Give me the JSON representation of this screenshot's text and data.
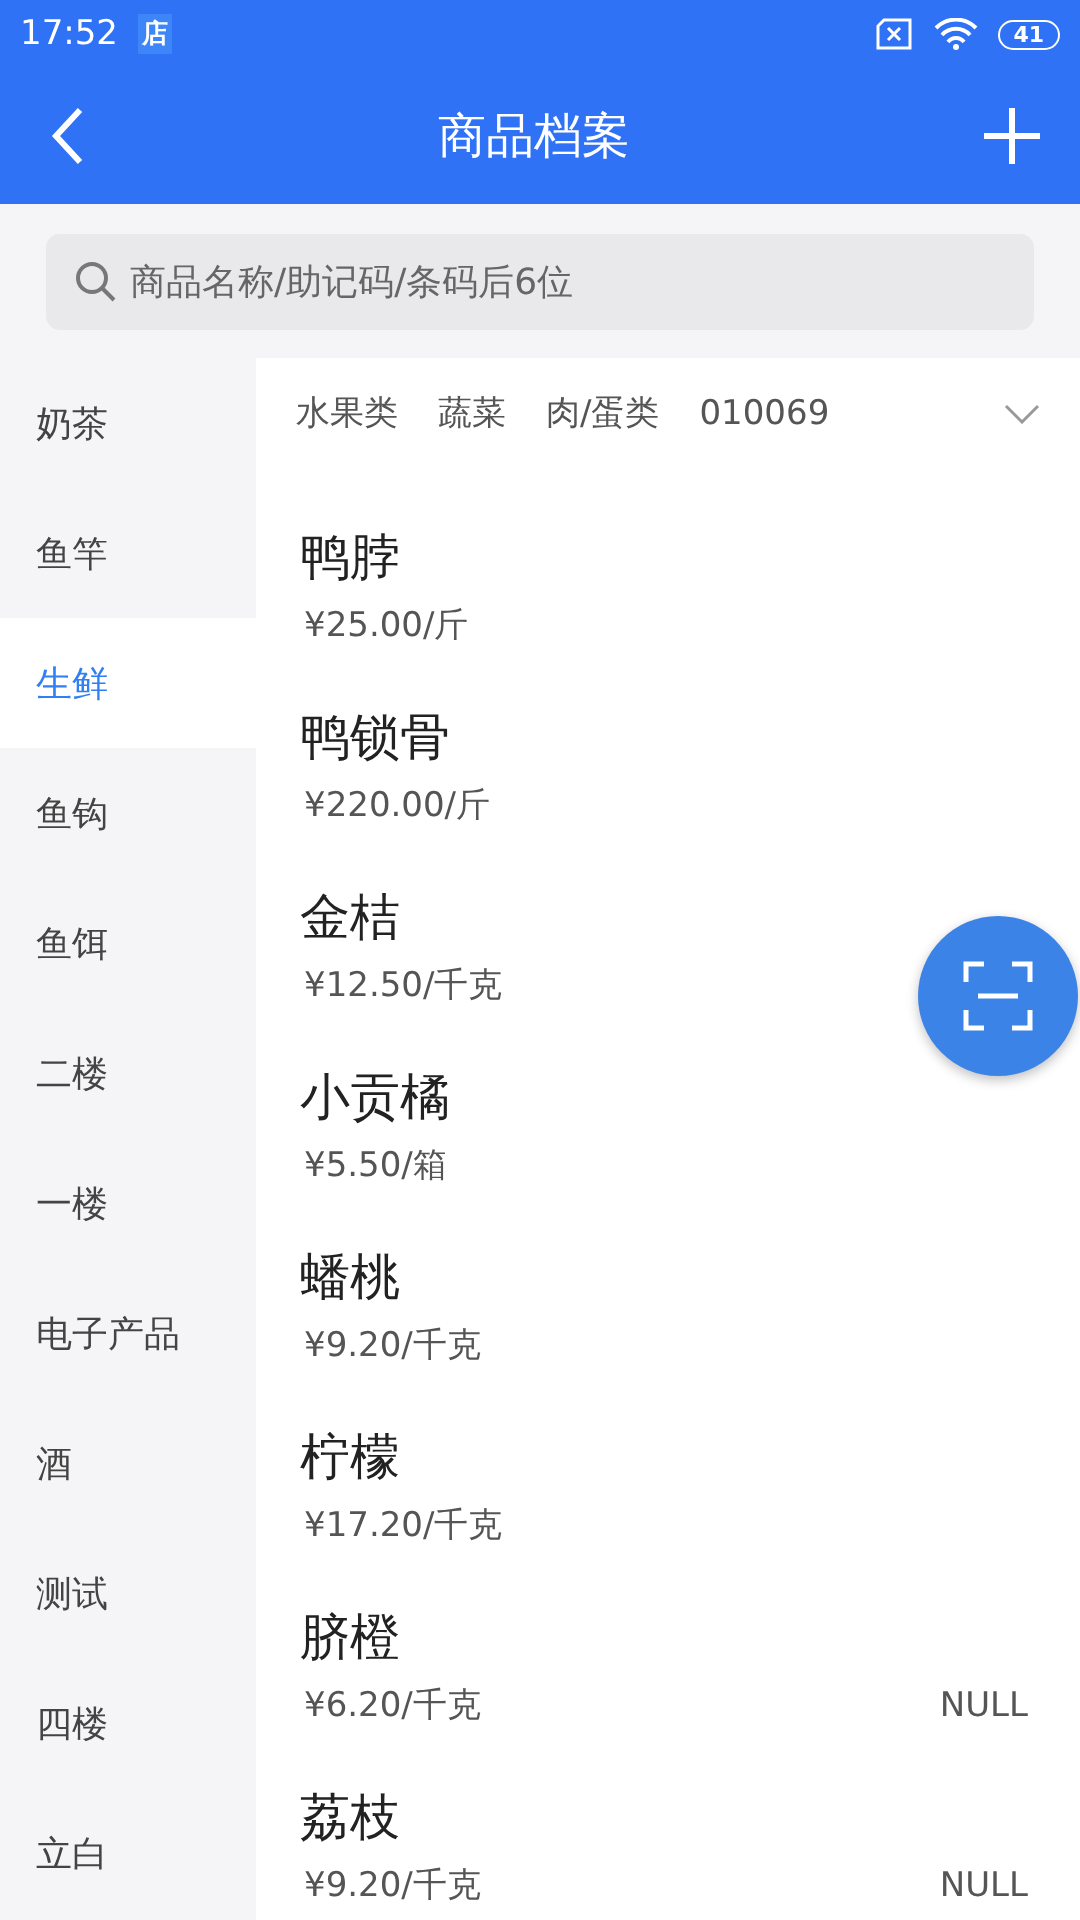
{
  "status_bar": {
    "time": "17:52",
    "app_badge": "店",
    "battery": "41"
  },
  "header": {
    "title": "商品档案"
  },
  "search": {
    "placeholder": "商品名称/助记码/条码后6位"
  },
  "sidebar": {
    "items": [
      {
        "label": "奶茶",
        "selected": false
      },
      {
        "label": "鱼竿",
        "selected": false
      },
      {
        "label": "生鲜",
        "selected": true
      },
      {
        "label": "鱼钩",
        "selected": false
      },
      {
        "label": "鱼饵",
        "selected": false
      },
      {
        "label": "二楼",
        "selected": false
      },
      {
        "label": "一楼",
        "selected": false
      },
      {
        "label": "电子产品",
        "selected": false
      },
      {
        "label": "酒",
        "selected": false
      },
      {
        "label": "测试",
        "selected": false
      },
      {
        "label": "四楼",
        "selected": false
      },
      {
        "label": "立白",
        "selected": false
      }
    ]
  },
  "subcategories": [
    {
      "label": "水果类",
      "selected": false
    },
    {
      "label": "蔬菜",
      "selected": false
    },
    {
      "label": "肉/蛋类",
      "selected": false
    },
    {
      "label": "010069",
      "selected": false
    }
  ],
  "products": [
    {
      "name": "鸭脖",
      "price": "¥25.00/斤"
    },
    {
      "name": "鸭锁骨",
      "price": "¥220.00/斤"
    },
    {
      "name": "金桔",
      "price": "¥12.50/千克"
    },
    {
      "name": "小贡橘",
      "price": "¥5.50/箱"
    },
    {
      "name": "蟠桃",
      "price": "¥9.20/千克"
    },
    {
      "name": "柠檬",
      "price": "¥17.20/千克"
    },
    {
      "name": "脐橙",
      "price": "¥6.20/千克",
      "note": "NULL"
    },
    {
      "name": "荔枝",
      "price": "¥9.20/千克",
      "note": "NULL"
    }
  ]
}
